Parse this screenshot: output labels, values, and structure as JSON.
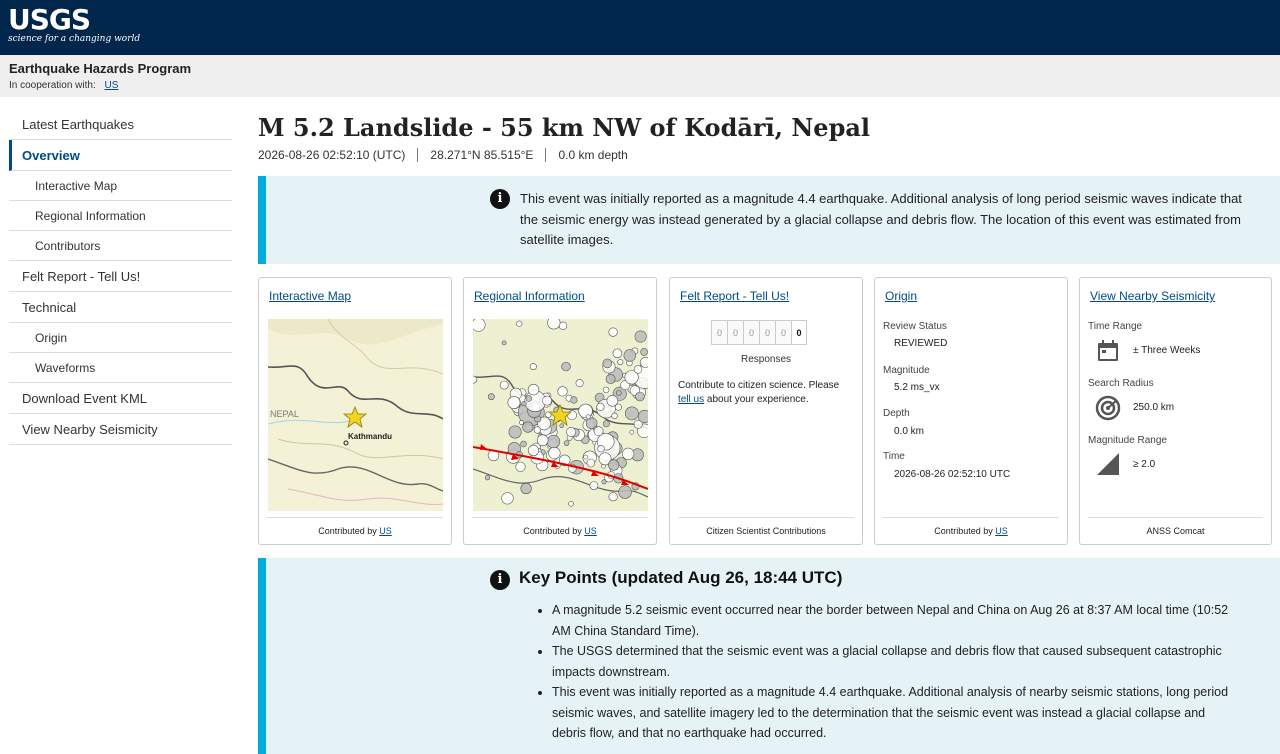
{
  "header": {
    "logo_text": "USGS",
    "logo_tagline": "science for a changing world",
    "program": "Earthquake Hazards Program",
    "cooperation_label": "In cooperation with:",
    "cooperation_link": "US"
  },
  "sidebar": {
    "items": [
      {
        "label": "Latest Earthquakes"
      },
      {
        "label": "Overview"
      },
      {
        "label": "Interactive Map"
      },
      {
        "label": "Regional Information"
      },
      {
        "label": "Contributors"
      },
      {
        "label": "Felt Report - Tell Us!"
      },
      {
        "label": "Technical"
      },
      {
        "label": "Origin"
      },
      {
        "label": "Waveforms"
      },
      {
        "label": "Download Event KML"
      },
      {
        "label": "View Nearby Seismicity"
      }
    ]
  },
  "event": {
    "title": "M 5.2 Landslide - 55 km NW of Kodārī, Nepal",
    "time": "2026-08-26 02:52:10 (UTC)",
    "location": "28.271°N 85.515°E",
    "depth": "0.0 km depth"
  },
  "notice": {
    "icon": "info-icon",
    "text": "This event was initially reported as a magnitude 4.4 earthquake. Additional analysis of long period seismic waves indicate that the seismic energy was instead generated by a glacial collapse and debris flow. The location of this event was estimated from satellite images."
  },
  "cards": {
    "interactive_map": {
      "title": "Interactive Map",
      "contributed_by": "Contributed by",
      "contributor": "US",
      "map_labels": {
        "country": "NEPAL",
        "city": "Kathmandu"
      }
    },
    "regional_info": {
      "title": "Regional Information",
      "contributed_by": "Contributed by",
      "contributor": "US"
    },
    "felt_report": {
      "title": "Felt Report - Tell Us!",
      "counter_digits": [
        "0",
        "0",
        "0",
        "0",
        "0",
        "0"
      ],
      "responses_label": "Responses",
      "contribute_text_1": "Contribute to citizen science. Please",
      "tell_us": "tell us",
      "contribute_text_2": "about your experience.",
      "footer": "Citizen Scientist Contributions"
    },
    "origin": {
      "title": "Origin",
      "review_status_label": "Review Status",
      "review_status": "REVIEWED",
      "magnitude_label": "Magnitude",
      "magnitude": "5.2 ms_vx",
      "depth_label": "Depth",
      "depth": "0.0 km",
      "time_label": "Time",
      "time": "2026-08-26 02:52:10 UTC",
      "contributed_by": "Contributed by",
      "contributor": "US"
    },
    "nearby": {
      "title": "View Nearby Seismicity",
      "time_range_label": "Time Range",
      "time_range": "± Three Weeks",
      "search_radius_label": "Search Radius",
      "search_radius": "250.0 km",
      "magnitude_range_label": "Magnitude Range",
      "magnitude_range": "≥ 2.0",
      "footer": "ANSS Comcat"
    }
  },
  "key_points": {
    "heading": "Key Points (updated Aug 26, 18:44 UTC)",
    "items": [
      "A magnitude 5.2 seismic event occurred near the border between Nepal and China on Aug 26 at 8:37 AM local time (10:52 AM China Standard Time).",
      "The USGS determined that the seismic event was a glacial collapse and debris flow that caused subsequent catastrophic impacts downstream.",
      "This event was initially reported as a magnitude 4.4 earthquake. Additional analysis of nearby seismic stations, long period seismic waves, and satellite imagery led to the determination that the seismic event was instead a glacial collapse and debris flow, and that no earthquake had occurred."
    ]
  },
  "colors": {
    "header_bg": "#00264c",
    "accent": "#00acd8",
    "link": "#004b87",
    "notice_bg": "#e5f3f7",
    "fault_line": "#e00000"
  }
}
